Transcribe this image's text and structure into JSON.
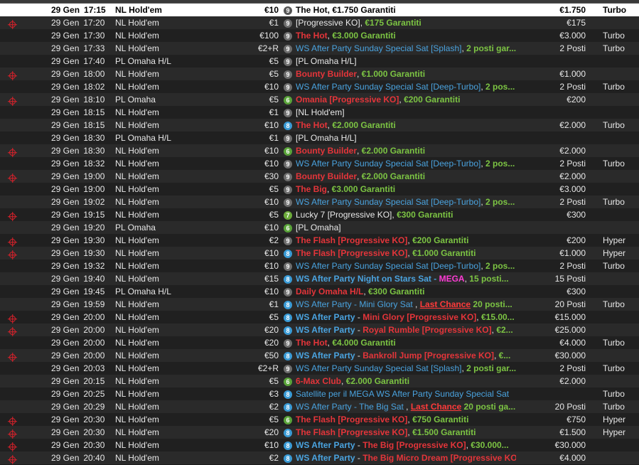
{
  "colors": {
    "red": "#e4353a",
    "green": "#7cc443",
    "blue": "#4aa3df",
    "magenta": "#ff3bd6",
    "seat9": "#6e6e6e",
    "seat8": "#3a9bd6",
    "seat6": "#5aa43a",
    "ko_icon": "#e0202a"
  },
  "rows": [
    {
      "ko": false,
      "sel": true,
      "date": "29 Gen",
      "time": "17:15",
      "game": "NL Hold'em",
      "buyin": "€10",
      "seats": "9",
      "prize": "€1.750",
      "speed": "Turbo",
      "name": [
        {
          "t": "The Hot",
          "c": "red"
        },
        {
          "t": ", ",
          "c": "white"
        },
        {
          "t": "€1.750 Garantiti",
          "c": "green"
        }
      ]
    },
    {
      "ko": true,
      "date": "29 Gen",
      "time": "17:20",
      "game": "NL Hold'em",
      "buyin": "€1",
      "seats": "9",
      "prize": "€175",
      "speed": "",
      "name": [
        {
          "t": "[Progressive KO], ",
          "c": "white"
        },
        {
          "t": "€175 Garantiti",
          "c": "green"
        }
      ]
    },
    {
      "ko": false,
      "date": "29 Gen",
      "time": "17:30",
      "game": "NL Hold'em",
      "buyin": "€100",
      "seats": "9",
      "prize": "€3.000",
      "speed": "Turbo",
      "name": [
        {
          "t": "The Hot",
          "c": "red"
        },
        {
          "t": ", ",
          "c": "white"
        },
        {
          "t": "€3.000 Garantiti",
          "c": "green"
        }
      ]
    },
    {
      "ko": false,
      "date": "29 Gen",
      "time": "17:33",
      "game": "NL Hold'em",
      "buyin": "€2+R",
      "seats": "9",
      "prize": "2 Posti",
      "speed": "Turbo",
      "name": [
        {
          "t": "WS After Party Sunday Special Sat [Splash]",
          "c": "blue"
        },
        {
          "t": ", ",
          "c": "white"
        },
        {
          "t": "2 posti gar...",
          "c": "green"
        }
      ]
    },
    {
      "ko": false,
      "date": "29 Gen",
      "time": "17:40",
      "game": "PL Omaha H/L",
      "buyin": "€5",
      "seats": "9",
      "prize": "",
      "speed": "",
      "name": [
        {
          "t": "[PL Omaha H/L]",
          "c": "white"
        }
      ]
    },
    {
      "ko": true,
      "date": "29 Gen",
      "time": "18:00",
      "game": "NL Hold'em",
      "buyin": "€5",
      "seats": "9",
      "prize": "€1.000",
      "speed": "",
      "name": [
        {
          "t": "Bounty Builder",
          "c": "red"
        },
        {
          "t": ", ",
          "c": "white"
        },
        {
          "t": "€1.000 Garantiti",
          "c": "green"
        }
      ]
    },
    {
      "ko": false,
      "date": "29 Gen",
      "time": "18:02",
      "game": "NL Hold'em",
      "buyin": "€10",
      "seats": "9",
      "prize": "2 Posti",
      "speed": "Turbo",
      "name": [
        {
          "t": "WS After Party Sunday Special Sat [Deep-Turbo]",
          "c": "blue"
        },
        {
          "t": ", ",
          "c": "white"
        },
        {
          "t": "2 pos...",
          "c": "green"
        }
      ]
    },
    {
      "ko": true,
      "date": "29 Gen",
      "time": "18:10",
      "game": "PL Omaha",
      "buyin": "€5",
      "seats": "6",
      "prize": "€200",
      "speed": "",
      "name": [
        {
          "t": "Omania [Progressive KO]",
          "c": "red"
        },
        {
          "t": ", ",
          "c": "white"
        },
        {
          "t": "€200 Garantiti",
          "c": "green"
        }
      ]
    },
    {
      "ko": false,
      "date": "29 Gen",
      "time": "18:15",
      "game": "NL Hold'em",
      "buyin": "€1",
      "seats": "9",
      "prize": "",
      "speed": "",
      "name": [
        {
          "t": "[NL Hold'em]",
          "c": "white"
        }
      ]
    },
    {
      "ko": false,
      "date": "29 Gen",
      "time": "18:15",
      "game": "NL Hold'em",
      "buyin": "€10",
      "seats": "8",
      "prize": "€2.000",
      "speed": "Turbo",
      "name": [
        {
          "t": "The Hot",
          "c": "red"
        },
        {
          "t": ", ",
          "c": "white"
        },
        {
          "t": "€2.000 Garantiti",
          "c": "green"
        }
      ]
    },
    {
      "ko": false,
      "date": "29 Gen",
      "time": "18:30",
      "game": "PL Omaha H/L",
      "buyin": "€1",
      "seats": "9",
      "prize": "",
      "speed": "",
      "name": [
        {
          "t": "[PL Omaha H/L]",
          "c": "white"
        }
      ]
    },
    {
      "ko": true,
      "date": "29 Gen",
      "time": "18:30",
      "game": "NL Hold'em",
      "buyin": "€10",
      "seats": "6",
      "prize": "€2.000",
      "speed": "",
      "name": [
        {
          "t": "Bounty Builder",
          "c": "red"
        },
        {
          "t": ", ",
          "c": "white"
        },
        {
          "t": "€2.000 Garantiti",
          "c": "green"
        }
      ]
    },
    {
      "ko": false,
      "date": "29 Gen",
      "time": "18:32",
      "game": "NL Hold'em",
      "buyin": "€10",
      "seats": "9",
      "prize": "2 Posti",
      "speed": "Turbo",
      "name": [
        {
          "t": "WS After Party Sunday Special Sat [Deep-Turbo]",
          "c": "blue"
        },
        {
          "t": ", ",
          "c": "white"
        },
        {
          "t": "2 pos...",
          "c": "green"
        }
      ]
    },
    {
      "ko": true,
      "date": "29 Gen",
      "time": "19:00",
      "game": "NL Hold'em",
      "buyin": "€30",
      "seats": "9",
      "prize": "€2.000",
      "speed": "",
      "name": [
        {
          "t": "Bounty Builder",
          "c": "red"
        },
        {
          "t": ", ",
          "c": "white"
        },
        {
          "t": "€2.000 Garantiti",
          "c": "green"
        }
      ]
    },
    {
      "ko": false,
      "date": "29 Gen",
      "time": "19:00",
      "game": "NL Hold'em",
      "buyin": "€5",
      "seats": "9",
      "prize": "€3.000",
      "speed": "",
      "name": [
        {
          "t": "The Big",
          "c": "red"
        },
        {
          "t": ", ",
          "c": "white"
        },
        {
          "t": "€3.000 Garantiti",
          "c": "green"
        }
      ]
    },
    {
      "ko": false,
      "date": "29 Gen",
      "time": "19:02",
      "game": "NL Hold'em",
      "buyin": "€10",
      "seats": "9",
      "prize": "2 Posti",
      "speed": "Turbo",
      "name": [
        {
          "t": "WS After Party Sunday Special Sat [Deep-Turbo]",
          "c": "blue"
        },
        {
          "t": ", ",
          "c": "white"
        },
        {
          "t": "2 pos...",
          "c": "green"
        }
      ]
    },
    {
      "ko": true,
      "date": "29 Gen",
      "time": "19:15",
      "game": "NL Hold'em",
      "buyin": "€5",
      "seats": "7",
      "prize": "€300",
      "speed": "",
      "name": [
        {
          "t": "Lucky 7 [Progressive KO], ",
          "c": "white"
        },
        {
          "t": "€300 Garantiti",
          "c": "green"
        }
      ]
    },
    {
      "ko": false,
      "date": "29 Gen",
      "time": "19:20",
      "game": "PL Omaha",
      "buyin": "€10",
      "seats": "6",
      "prize": "",
      "speed": "",
      "name": [
        {
          "t": "[PL Omaha]",
          "c": "white"
        }
      ]
    },
    {
      "ko": true,
      "date": "29 Gen",
      "time": "19:30",
      "game": "NL Hold'em",
      "buyin": "€2",
      "seats": "9",
      "prize": "€200",
      "speed": "Hyper",
      "name": [
        {
          "t": "The Flash [Progressive KO]",
          "c": "red"
        },
        {
          "t": ", ",
          "c": "white"
        },
        {
          "t": "€200 Garantiti",
          "c": "green"
        }
      ]
    },
    {
      "ko": true,
      "date": "29 Gen",
      "time": "19:30",
      "game": "NL Hold'em",
      "buyin": "€10",
      "seats": "8",
      "prize": "€1.000",
      "speed": "Hyper",
      "name": [
        {
          "t": "The Flash [Progressive KO]",
          "c": "red"
        },
        {
          "t": ", ",
          "c": "white"
        },
        {
          "t": "€1.000 Garantiti",
          "c": "green"
        }
      ]
    },
    {
      "ko": false,
      "date": "29 Gen",
      "time": "19:32",
      "game": "NL Hold'em",
      "buyin": "€10",
      "seats": "9",
      "prize": "2 Posti",
      "speed": "Turbo",
      "name": [
        {
          "t": "WS After Party Sunday Special Sat [Deep-Turbo]",
          "c": "blue"
        },
        {
          "t": ", ",
          "c": "white"
        },
        {
          "t": "2 pos...",
          "c": "green"
        }
      ]
    },
    {
      "ko": false,
      "date": "29 Gen",
      "time": "19:40",
      "game": "NL Hold'em",
      "buyin": "€15",
      "seats": "8",
      "prize": "15 Posti",
      "speed": "",
      "name": [
        {
          "t": "WS After Party Night on Stars Sat - ",
          "c": "blueb"
        },
        {
          "t": "MEGA",
          "c": "mag"
        },
        {
          "t": ", ",
          "c": "white"
        },
        {
          "t": "15 posti...",
          "c": "green"
        }
      ]
    },
    {
      "ko": false,
      "date": "29 Gen",
      "time": "19:45",
      "game": "PL Omaha H/L",
      "buyin": "€10",
      "seats": "9",
      "prize": "€300",
      "speed": "",
      "name": [
        {
          "t": "Daily Omaha H/L",
          "c": "red"
        },
        {
          "t": ", ",
          "c": "white"
        },
        {
          "t": "€300 Garantiti",
          "c": "green"
        }
      ]
    },
    {
      "ko": false,
      "date": "29 Gen",
      "time": "19:59",
      "game": "NL Hold'em",
      "buyin": "€1",
      "seats": "8",
      "prize": "20 Posti",
      "speed": "Turbo",
      "name": [
        {
          "t": "WS After Party - Mini Glory Sat ",
          "c": "blue"
        },
        {
          "t": ", ",
          "c": "white"
        },
        {
          "t": "Last Chance",
          "c": "chance"
        },
        {
          "t": " 20 posti...",
          "c": "green"
        }
      ]
    },
    {
      "ko": true,
      "date": "29 Gen",
      "time": "20:00",
      "game": "NL Hold'em",
      "buyin": "€5",
      "seats": "8",
      "prize": "€15.000",
      "speed": "",
      "name": [
        {
          "t": "WS After Party",
          "c": "blueb"
        },
        {
          "t": " - ",
          "c": "white"
        },
        {
          "t": "Mini Glory [Progressive KO]",
          "c": "red"
        },
        {
          "t": ", ",
          "c": "white"
        },
        {
          "t": "€15.00...",
          "c": "green"
        }
      ]
    },
    {
      "ko": true,
      "date": "29 Gen",
      "time": "20:00",
      "game": "NL Hold'em",
      "buyin": "€20",
      "seats": "8",
      "prize": "€25.000",
      "speed": "",
      "name": [
        {
          "t": "WS After Party",
          "c": "blueb"
        },
        {
          "t": " - ",
          "c": "white"
        },
        {
          "t": "Royal Rumble [Progressive KO]",
          "c": "red"
        },
        {
          "t": ", ",
          "c": "white"
        },
        {
          "t": "€2...",
          "c": "green"
        }
      ]
    },
    {
      "ko": false,
      "date": "29 Gen",
      "time": "20:00",
      "game": "NL Hold'em",
      "buyin": "€20",
      "seats": "9",
      "prize": "€4.000",
      "speed": "Turbo",
      "name": [
        {
          "t": "The Hot",
          "c": "red"
        },
        {
          "t": ", ",
          "c": "white"
        },
        {
          "t": "€4.000 Garantiti",
          "c": "green"
        }
      ]
    },
    {
      "ko": true,
      "date": "29 Gen",
      "time": "20:00",
      "game": "NL Hold'em",
      "buyin": "€50",
      "seats": "8",
      "prize": "€30.000",
      "speed": "",
      "name": [
        {
          "t": "WS After Party",
          "c": "blueb"
        },
        {
          "t": " - ",
          "c": "white"
        },
        {
          "t": "Bankroll Jump [Progressive KO]",
          "c": "red"
        },
        {
          "t": ", ",
          "c": "white"
        },
        {
          "t": "€...",
          "c": "green"
        }
      ]
    },
    {
      "ko": false,
      "date": "29 Gen",
      "time": "20:03",
      "game": "NL Hold'em",
      "buyin": "€2+R",
      "seats": "9",
      "prize": "2 Posti",
      "speed": "Turbo",
      "name": [
        {
          "t": "WS After Party Sunday Special Sat [Splash]",
          "c": "blue"
        },
        {
          "t": ", ",
          "c": "white"
        },
        {
          "t": "2 posti gar...",
          "c": "green"
        }
      ]
    },
    {
      "ko": false,
      "date": "29 Gen",
      "time": "20:15",
      "game": "NL Hold'em",
      "buyin": "€5",
      "seats": "6",
      "prize": "€2.000",
      "speed": "",
      "name": [
        {
          "t": "6-Max Club",
          "c": "red"
        },
        {
          "t": ", ",
          "c": "white"
        },
        {
          "t": "€2.000 Garantiti",
          "c": "green"
        }
      ]
    },
    {
      "ko": false,
      "date": "29 Gen",
      "time": "20:25",
      "game": "NL Hold'em",
      "buyin": "€3",
      "seats": "8",
      "prize": "",
      "speed": "Turbo",
      "name": [
        {
          "t": "Satellite per il MEGA WS After Party Sunday Special Sat",
          "c": "blue"
        }
      ]
    },
    {
      "ko": false,
      "date": "29 Gen",
      "time": "20:29",
      "game": "NL Hold'em",
      "buyin": "€2",
      "seats": "8",
      "prize": "20 Posti",
      "speed": "Turbo",
      "name": [
        {
          "t": "WS After Party - The Big Sat ",
          "c": "blue"
        },
        {
          "t": ", ",
          "c": "white"
        },
        {
          "t": "Last Chance",
          "c": "chance"
        },
        {
          "t": " 20 posti ga...",
          "c": "green"
        }
      ]
    },
    {
      "ko": true,
      "date": "29 Gen",
      "time": "20:30",
      "game": "NL Hold'em",
      "buyin": "€5",
      "seats": "6",
      "prize": "€750",
      "speed": "Hyper",
      "name": [
        {
          "t": "The Flash [Progressive KO]",
          "c": "red"
        },
        {
          "t": ", ",
          "c": "white"
        },
        {
          "t": "€750 Garantiti",
          "c": "green"
        }
      ]
    },
    {
      "ko": true,
      "date": "29 Gen",
      "time": "20:30",
      "game": "NL Hold'em",
      "buyin": "€20",
      "seats": "8",
      "prize": "€1.500",
      "speed": "Hyper",
      "name": [
        {
          "t": "The Flash [Progressive KO]",
          "c": "red"
        },
        {
          "t": ", ",
          "c": "white"
        },
        {
          "t": "€1.500 Garantiti",
          "c": "green"
        }
      ]
    },
    {
      "ko": true,
      "date": "29 Gen",
      "time": "20:30",
      "game": "NL Hold'em",
      "buyin": "€10",
      "seats": "8",
      "prize": "€30.000",
      "speed": "",
      "name": [
        {
          "t": "WS After Party",
          "c": "blueb"
        },
        {
          "t": " - ",
          "c": "white"
        },
        {
          "t": "The Big [Progressive KO]",
          "c": "red"
        },
        {
          "t": ", ",
          "c": "white"
        },
        {
          "t": "€30.000...",
          "c": "green"
        }
      ]
    },
    {
      "ko": true,
      "date": "29 Gen",
      "time": "20:40",
      "game": "NL Hold'em",
      "buyin": "€2",
      "seats": "8",
      "prize": "€4.000",
      "speed": "",
      "name": [
        {
          "t": "WS After Party",
          "c": "blueb"
        },
        {
          "t": " - ",
          "c": "white"
        },
        {
          "t": "The Big Micro Dream [Progressive KO],",
          "c": "red"
        }
      ]
    }
  ]
}
